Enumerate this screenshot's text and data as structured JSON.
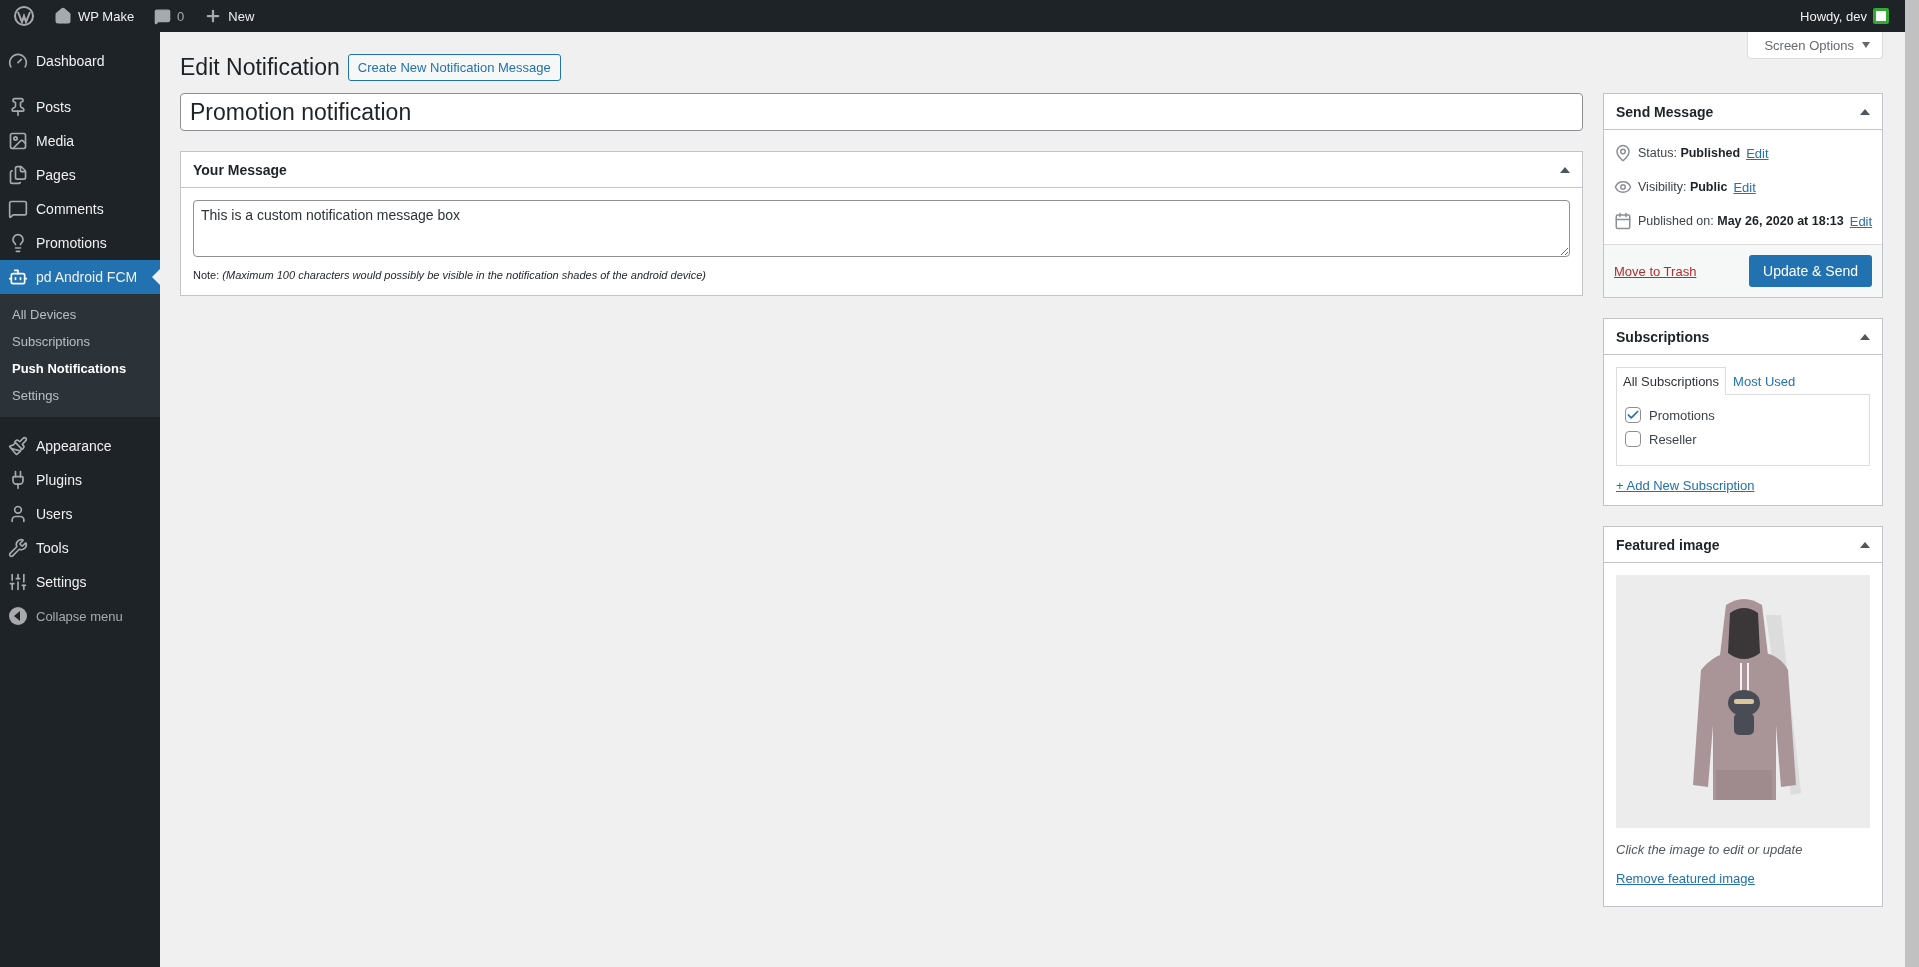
{
  "admin_bar": {
    "site": "WP Make",
    "comments": "0",
    "new": "New",
    "greeting": "Howdy, dev"
  },
  "sidebar": {
    "sections": [
      [
        {
          "label": "Dashboard",
          "selected": false
        }
      ],
      [
        {
          "label": "Posts",
          "selected": false
        },
        {
          "label": "Media",
          "selected": false
        },
        {
          "label": "Pages",
          "selected": false
        },
        {
          "label": "Comments",
          "selected": false
        },
        {
          "label": "Promotions",
          "selected": false
        },
        {
          "label": "pd Android FCM",
          "selected": true,
          "children": [
            {
              "label": "All Devices",
              "selected": false
            },
            {
              "label": "Subscriptions",
              "selected": false
            },
            {
              "label": "Push Notifications",
              "selected": true
            },
            {
              "label": "Settings",
              "selected": false
            }
          ]
        }
      ],
      [
        {
          "label": "Appearance",
          "selected": false
        },
        {
          "label": "Plugins",
          "selected": false
        },
        {
          "label": "Users",
          "selected": false
        },
        {
          "label": "Tools",
          "selected": false
        },
        {
          "label": "Settings",
          "selected": false
        }
      ]
    ],
    "collapse": "Collapse menu"
  },
  "screen_options": "Screen Options",
  "heading": "Edit Notification",
  "add_new_button": "Create New Notification Message",
  "title_field": {
    "value": "Promotion notification"
  },
  "message_box": {
    "title": "Your Message",
    "value": "This is a custom notification message box",
    "note": "Note: *(Maximum 100 characters would possibly be visible in the notification shades of the android device)*"
  },
  "send_box": {
    "title": "Send Message",
    "rows": [
      {
        "text": "Status: **Published**",
        "link": "Edit"
      },
      {
        "text": "Visibility: **Public**",
        "link": "Edit"
      },
      {
        "text": "Published on: **May 26, 2020 at 18:13**",
        "link": "Edit"
      }
    ],
    "trash": "Move to Trash",
    "submit": "Update & Send"
  },
  "subscriptions_box": {
    "title": "Subscriptions",
    "tabs": [
      {
        "label": "All Subscriptions",
        "selected": true
      },
      {
        "label": "Most Used",
        "selected": false
      }
    ],
    "items": [
      {
        "label": "Promotions",
        "checked": true
      },
      {
        "label": "Reseller",
        "checked": false
      }
    ],
    "add_link": "+ Add New Subscription"
  },
  "featured_box": {
    "title": "Featured image",
    "caption": "Click the image to edit or update",
    "remove": "Remove featured image"
  }
}
